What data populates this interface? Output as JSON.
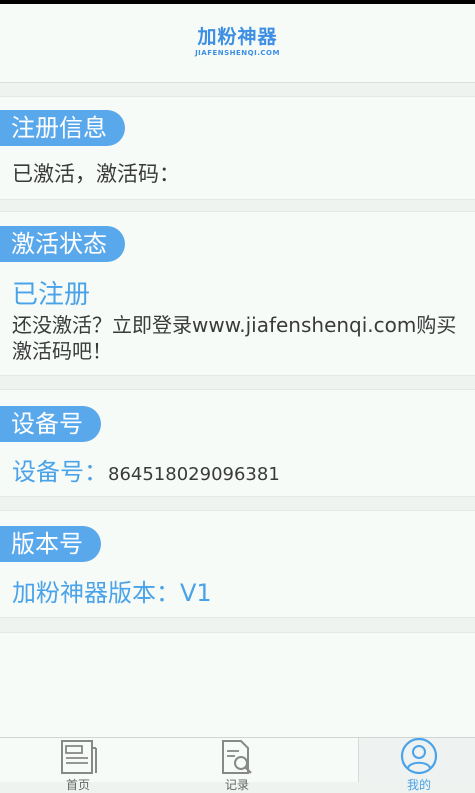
{
  "header": {
    "logo_title": "加粉神器",
    "logo_subtitle": "JIAFENSHENQI.COM"
  },
  "registration": {
    "tag": "注册信息",
    "text": "已激活，激活码："
  },
  "activation": {
    "tag": "激活状态",
    "status": "已注册",
    "hint": "还没激活？立即登录www.jiafenshenqi.com购买激活码吧！"
  },
  "device": {
    "tag": "设备号",
    "label": "设备号：",
    "value": "864518029096381"
  },
  "version": {
    "tag": "版本号",
    "text": "加粉神器版本：V1"
  },
  "tabs": [
    {
      "icon": "document-icon",
      "label": "首页"
    },
    {
      "icon": "search-document-icon",
      "label": "记录"
    },
    {
      "icon": "user-icon",
      "label": "我的"
    }
  ],
  "colors": {
    "accent": "#5aa8ec",
    "text_blue": "#4aa3e8",
    "background": "#eef3f0"
  }
}
